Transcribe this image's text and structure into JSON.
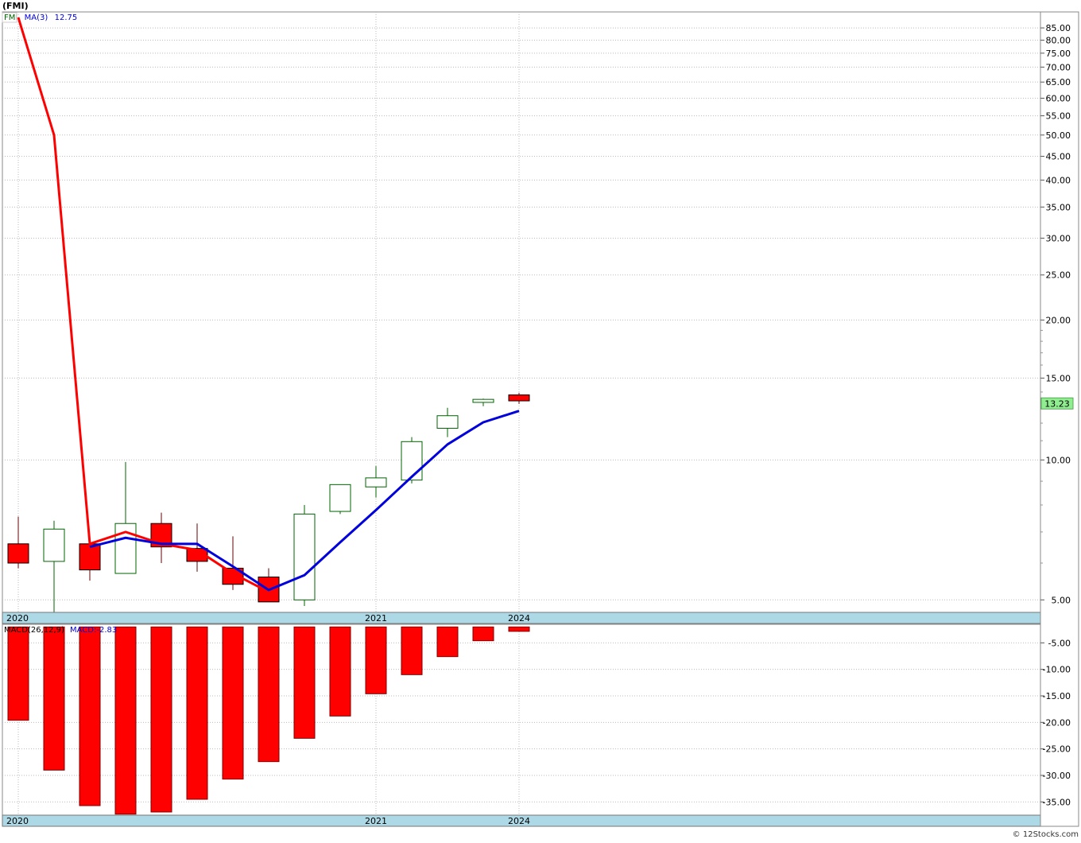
{
  "page": {
    "symbol_title": "(FMI)",
    "copyright": "© 12Stocks.com"
  },
  "colors": {
    "up_candle": "#006400",
    "down_candle": "#ff0000",
    "ma_line": "#0000dd",
    "close_line": "#ff0000",
    "axis_bar": "#add8e6",
    "grid": "#bbbbbb",
    "price_tag_bg": "#90ee90"
  },
  "chart_data": [
    {
      "type": "candlestick",
      "title": "(FMI)",
      "legend": [
        {
          "label": "FMI",
          "color": "#006400"
        },
        {
          "label": "MA(3)",
          "color": "#0000dd"
        },
        {
          "label": "12.75",
          "color": "#0000dd"
        }
      ],
      "y_scale": "log",
      "ylim": [
        4.7,
        92
      ],
      "y_ticks": [
        5,
        10,
        15,
        20,
        25,
        30,
        35,
        40,
        45,
        50,
        55,
        60,
        65,
        70,
        75,
        80,
        85
      ],
      "y_tick_labels": [
        "5.00",
        "10.00",
        "15.00",
        "20.00",
        "25.00",
        "30.00",
        "35.00",
        "40.00",
        "45.00",
        "50.00",
        "55.00",
        "60.00",
        "65.00",
        "70.00",
        "75.00",
        "80.00",
        "85.00"
      ],
      "x_axis_labels": [
        {
          "label": "2020",
          "index": 0
        },
        {
          "label": "2021",
          "index": 10
        },
        {
          "label": "2024",
          "index": 14
        }
      ],
      "last_price_label": "13.23",
      "last_price": 13.23,
      "candles": [
        {
          "open": 6.6,
          "high": 7.55,
          "low": 5.85,
          "close": 6.0
        },
        {
          "open": 6.05,
          "high": 7.4,
          "low": 4.7,
          "close": 7.1
        },
        {
          "open": 6.6,
          "high": 6.6,
          "low": 5.5,
          "close": 5.8
        },
        {
          "open": 5.7,
          "high": 9.9,
          "low": 5.7,
          "close": 7.3
        },
        {
          "open": 7.3,
          "high": 7.7,
          "low": 6.0,
          "close": 6.5
        },
        {
          "open": 6.45,
          "high": 7.3,
          "low": 5.75,
          "close": 6.05
        },
        {
          "open": 5.85,
          "high": 6.85,
          "low": 5.25,
          "close": 5.4
        },
        {
          "open": 5.6,
          "high": 5.85,
          "low": 5.05,
          "close": 4.95
        },
        {
          "open": 5.0,
          "high": 8.0,
          "low": 4.85,
          "close": 7.65
        },
        {
          "open": 7.75,
          "high": 8.45,
          "low": 7.65,
          "close": 8.85
        },
        {
          "open": 8.75,
          "high": 9.7,
          "low": 8.3,
          "close": 9.15
        },
        {
          "open": 9.05,
          "high": 11.2,
          "low": 8.9,
          "close": 10.95
        },
        {
          "open": 11.7,
          "high": 12.95,
          "low": 11.2,
          "close": 12.45
        },
        {
          "open": 13.3,
          "high": 13.55,
          "low": 13.05,
          "close": 13.5
        },
        {
          "open": 13.8,
          "high": 13.95,
          "low": 13.2,
          "close": 13.4
        }
      ],
      "close_line": [
        89.5,
        50.0,
        6.6,
        7.0,
        6.6,
        6.4,
        5.7,
        5.2
      ],
      "ma3": [
        null,
        null,
        6.5,
        6.8,
        6.6,
        6.6,
        5.9,
        5.25,
        5.65,
        6.65,
        7.8,
        9.2,
        10.8,
        12.05,
        12.75
      ]
    },
    {
      "type": "bar",
      "title": "MACD(26,12,9)",
      "legend": [
        {
          "label": "MACD(26,12,9)",
          "color": "#000000"
        },
        {
          "label": "MACD:-2.83",
          "color": "#0000dd"
        }
      ],
      "ylim": [
        -37.5,
        -1.5
      ],
      "y_ticks": [
        -5,
        -10,
        -15,
        -20,
        -25,
        -30,
        -35
      ],
      "y_tick_labels": [
        "-5.00",
        "-10.00",
        "-15.00",
        "-20.00",
        "-25.00",
        "-30.00",
        "-35.00"
      ],
      "baseline": -2.0,
      "values": [
        -19.6,
        -29.0,
        -35.7,
        -37.3,
        -36.9,
        -34.5,
        -30.7,
        -27.4,
        -23.0,
        -18.8,
        -14.6,
        -11.0,
        -7.6,
        -4.6,
        -2.83
      ],
      "x_axis_labels": [
        {
          "label": "2020",
          "index": 0
        },
        {
          "label": "2021",
          "index": 10
        },
        {
          "label": "2024",
          "index": 14
        }
      ]
    }
  ]
}
